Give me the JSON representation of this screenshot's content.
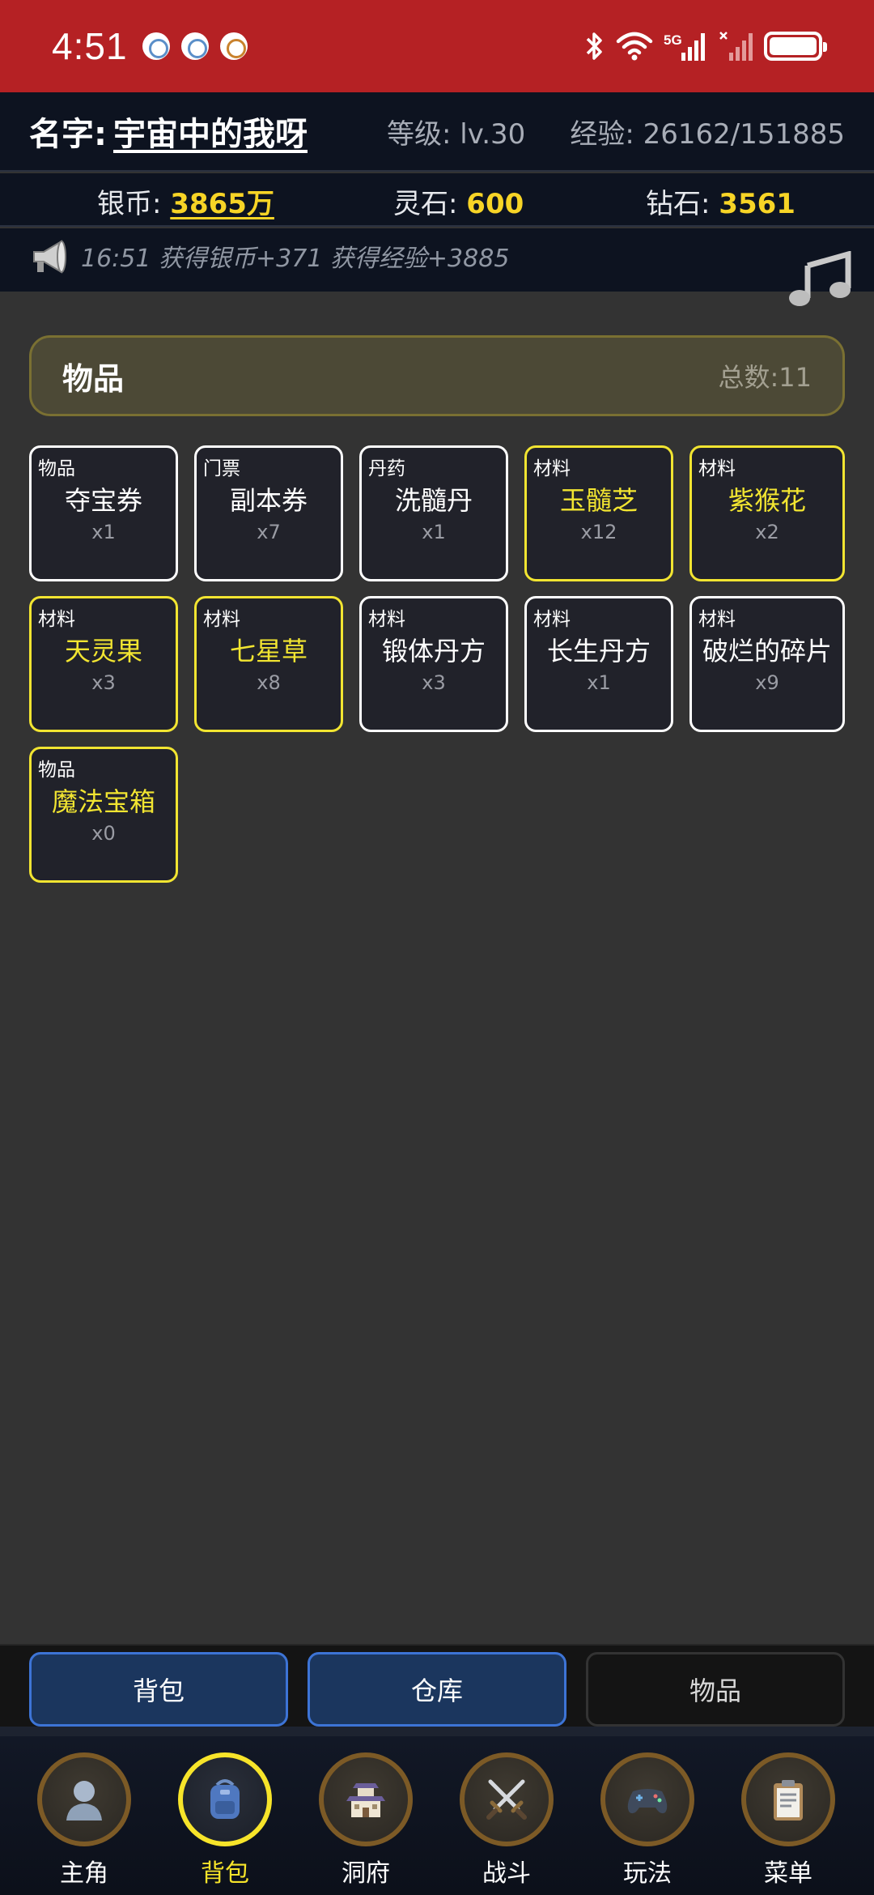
{
  "status_bar": {
    "time": "4:51",
    "notification_icons": [
      "app-notification-icon",
      "app-notification-icon",
      "app-notification-icon"
    ],
    "network": "5G",
    "bg_color": "#b52124"
  },
  "player": {
    "name_label": "名字:",
    "name": "宇宙中的我呀",
    "level": "等级: lv.30",
    "exp": "经验: 26162/151885"
  },
  "currency": {
    "silver_label": "银币:",
    "silver_value": "3865万",
    "spirit_label": "灵石:",
    "spirit_value": "600",
    "diamond_label": "钻石:",
    "diamond_value": "3561",
    "value_color": "#f7d426"
  },
  "log": {
    "message": "16:51 获得银币+371 获得经验+3885"
  },
  "inventory": {
    "title": "物品",
    "total": "总数:11",
    "items": [
      {
        "category": "物品",
        "name": "夺宝券",
        "qty": "x1",
        "rare": false
      },
      {
        "category": "门票",
        "name": "副本券",
        "qty": "x7",
        "rare": false
      },
      {
        "category": "丹药",
        "name": "洗髓丹",
        "qty": "x1",
        "rare": false
      },
      {
        "category": "材料",
        "name": "玉髓芝",
        "qty": "x12",
        "rare": true
      },
      {
        "category": "材料",
        "name": "紫猴花",
        "qty": "x2",
        "rare": true
      },
      {
        "category": "材料",
        "name": "天灵果",
        "qty": "x3",
        "rare": true
      },
      {
        "category": "材料",
        "name": "七星草",
        "qty": "x8",
        "rare": true
      },
      {
        "category": "材料",
        "name": "锻体丹方",
        "qty": "x3",
        "rare": false
      },
      {
        "category": "材料",
        "name": "长生丹方",
        "qty": "x1",
        "rare": false
      },
      {
        "category": "材料",
        "name": "破烂的碎片",
        "qty": "x9",
        "rare": false
      },
      {
        "category": "物品",
        "name": "魔法宝箱",
        "qty": "x0",
        "rare": true
      }
    ],
    "rare_color": "#f2e531"
  },
  "tabs": {
    "backpack": "背包",
    "warehouse": "仓库",
    "items": "物品"
  },
  "nav": [
    {
      "label": "主角",
      "icon": "character-icon",
      "active": false
    },
    {
      "label": "背包",
      "icon": "backpack-icon",
      "active": true
    },
    {
      "label": "洞府",
      "icon": "palace-icon",
      "active": false
    },
    {
      "label": "战斗",
      "icon": "crossed-swords-icon",
      "active": false
    },
    {
      "label": "玩法",
      "icon": "gamepad-icon",
      "active": false
    },
    {
      "label": "菜单",
      "icon": "clipboard-icon",
      "active": false
    }
  ],
  "nav_active_color": "#f7e42a"
}
